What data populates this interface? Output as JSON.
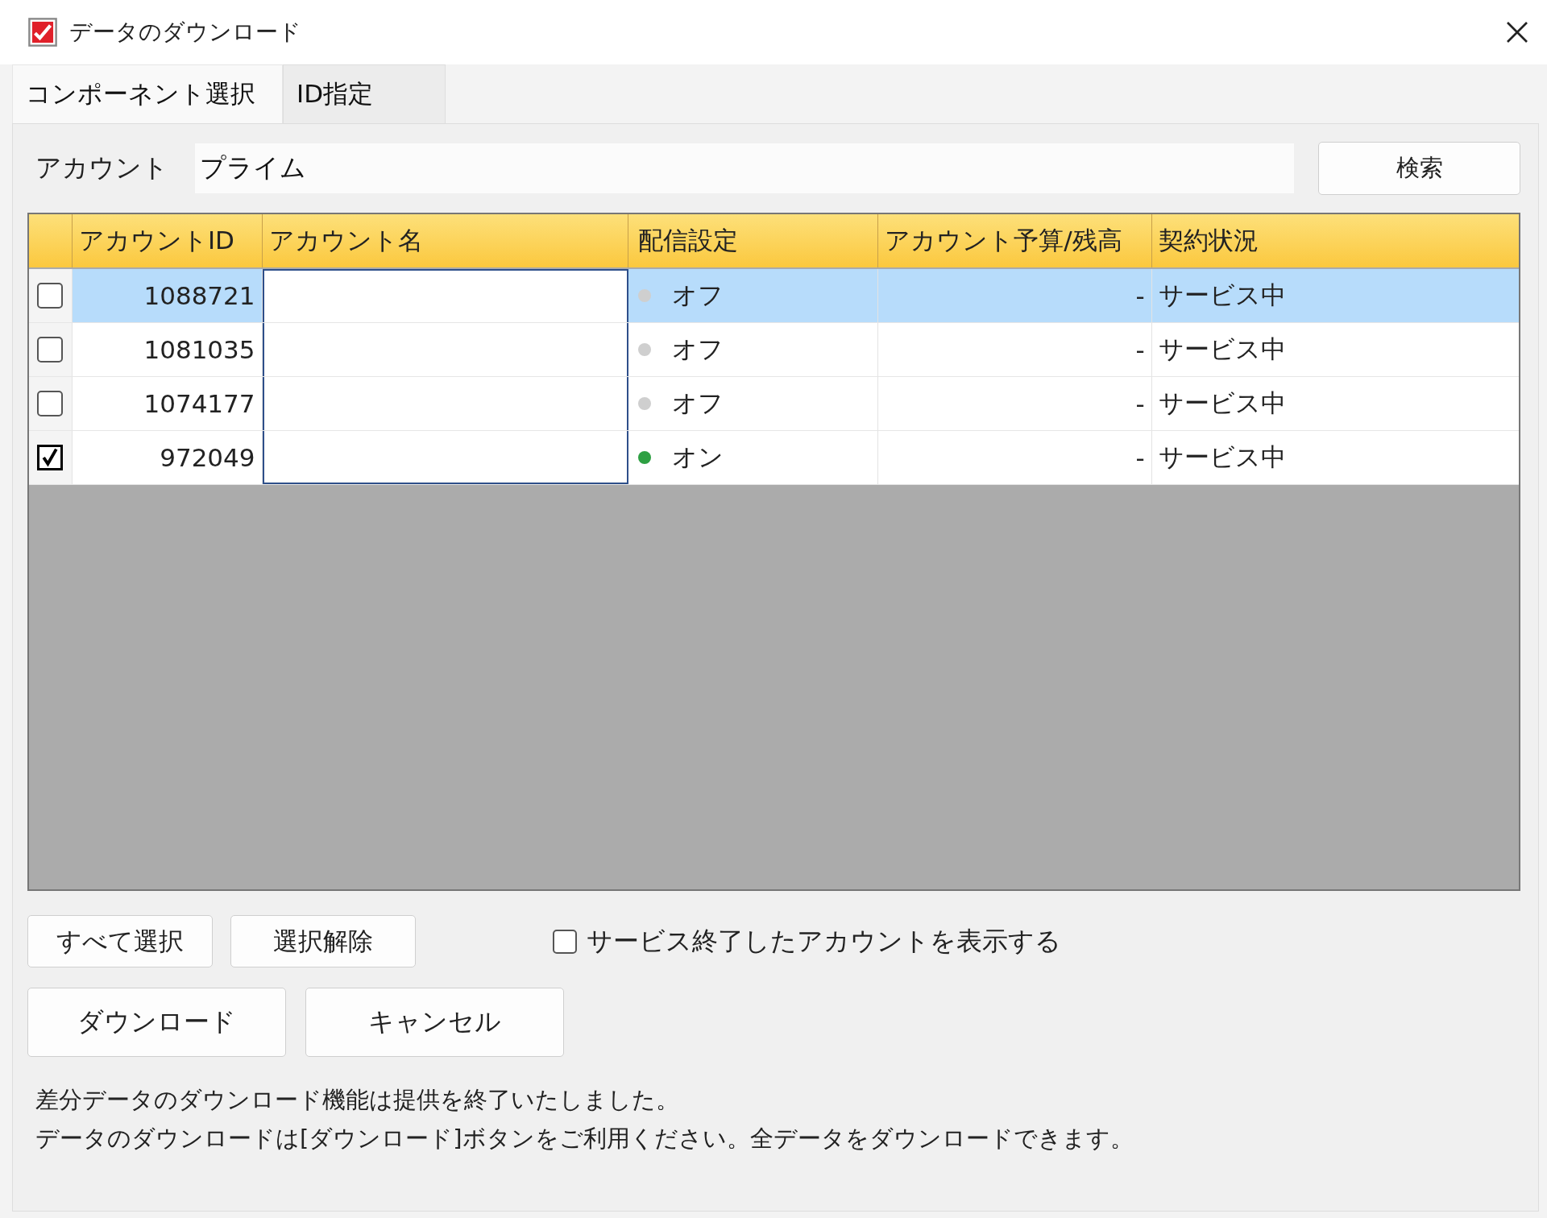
{
  "window": {
    "title": "データのダウンロード"
  },
  "tabs": [
    {
      "label": "コンポーネント選択",
      "selected": true
    },
    {
      "label": "ID指定",
      "selected": false
    }
  ],
  "account_field": {
    "label": "アカウント",
    "value": "プライム"
  },
  "search_button": "検索",
  "table": {
    "columns": [
      "アカウントID",
      "アカウント名",
      "配信設定",
      "アカウント予算/残高",
      "契約状況"
    ],
    "rows": [
      {
        "checked": false,
        "selected": true,
        "id": "1088721",
        "delivery": "オフ",
        "on": false,
        "budget": "-",
        "status": "サービス中"
      },
      {
        "checked": false,
        "selected": false,
        "id": "1081035",
        "delivery": "オフ",
        "on": false,
        "budget": "-",
        "status": "サービス中"
      },
      {
        "checked": false,
        "selected": false,
        "id": "1074177",
        "delivery": "オフ",
        "on": false,
        "budget": "-",
        "status": "サービス中"
      },
      {
        "checked": true,
        "selected": false,
        "id": "972049",
        "delivery": "オン",
        "on": true,
        "budget": "-",
        "status": "サービス中"
      }
    ]
  },
  "select_buttons": [
    "すべて選択",
    "選択解除"
  ],
  "show_ended": {
    "label": "サービス終了したアカウントを表示する",
    "checked": false
  },
  "action_buttons": [
    "ダウンロード",
    "キャンセル"
  ],
  "notes": [
    "差分データのダウンロード機能は提供を終了いたしました。",
    "データのダウンロードは[ダウンロード]ボタンをご利用ください。全データをダウンロードできます。"
  ]
}
